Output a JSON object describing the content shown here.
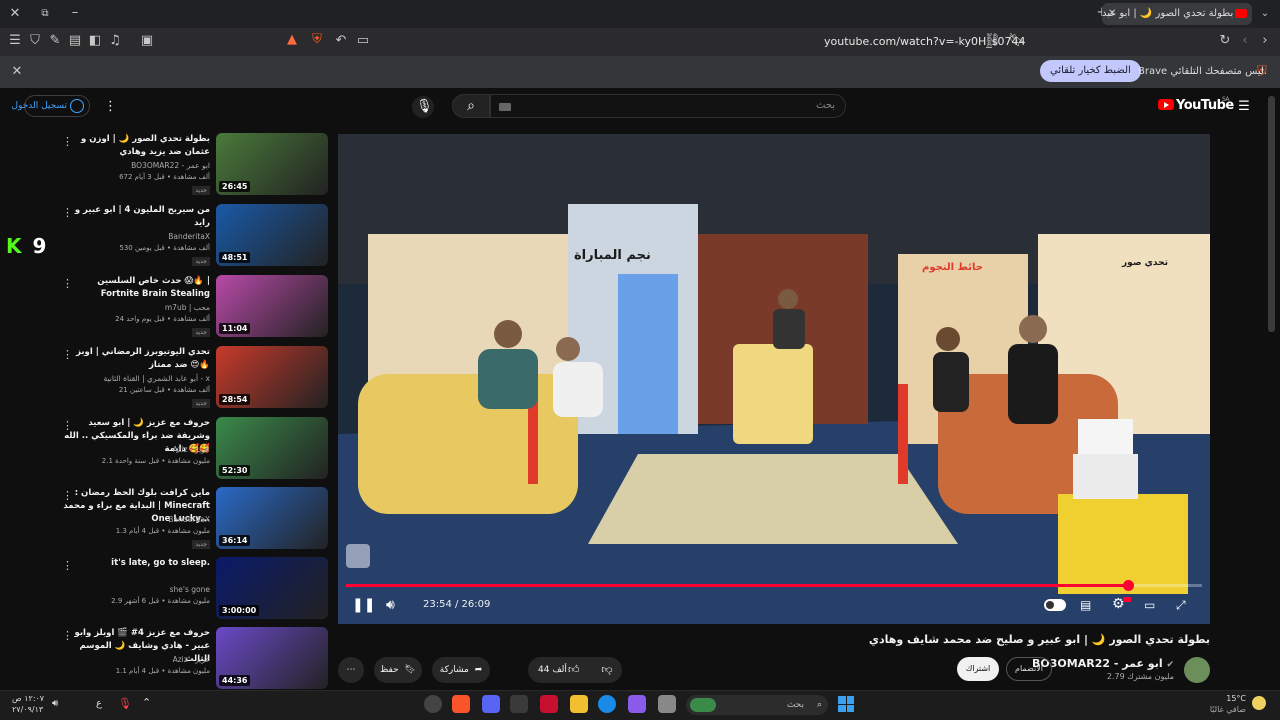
{
  "browser": {
    "tab_title": "بطولة تحدي الصور 🌙 | ابو عبد",
    "url": "youtube.com/watch?v=-ky0H_s0744",
    "shield_count": "98",
    "infobar_text": "Brave ليس متصفحك التلقائي.",
    "infobar_button": "الضبط كخيار تلقائي"
  },
  "header": {
    "logo_text": "YouTube",
    "logo_region": "SA",
    "search_placeholder": "بحث",
    "signin_label": "تسجيل الدخول"
  },
  "overlay_badge": {
    "letter": "K",
    "number": "9"
  },
  "recommendations": [
    {
      "title": "بطولة تحدي الصور 🌙 | اوزن و عثمان ضد يزيد وهادي",
      "channel": "BO3OMAR22 - ابو عمر",
      "stats": "672 ألف مشاهدة • قبل 3 أيام",
      "duration": "26:45",
      "badge": "جديد",
      "thumb": "#4a7a3a"
    },
    {
      "title": "من سيربح المليون 4 | ابو عبير و رايد",
      "channel": "BanderitaX",
      "stats": "530 ألف مشاهدة • قبل يومين",
      "duration": "48:51",
      "badge": "جديد",
      "thumb": "#1a5aa8"
    },
    {
      "title": "حدث خاص السلسين 😱🔥 | Fortnite Brain Stealing",
      "channel": "m7ub | محب",
      "stats": "24 ألف مشاهدة • قبل يوم واحد",
      "duration": "11:04",
      "badge": "جديد",
      "thumb": "#b84aa8"
    },
    {
      "title": "تحدي اليوتيوبرز الرمضاني | اوبز ضد ممتاز 😍🔥",
      "channel": "أبو عابد الشمري | القناة الثانية - x",
      "stats": "21 ألف مشاهدة • قبل ساعتين",
      "duration": "28:54",
      "badge": "جديد",
      "thumb": "#c83a2a"
    },
    {
      "title": "حروف مع عزيز 🌙 | ابو سعيد وشريفة ضد براء والمكسيكي .. الله دايمة 🥰🥰",
      "channel": "Aziz - عزيز",
      "stats": "2.1 مليون مشاهدة • قبل سنة واحدة",
      "duration": "52:30",
      "badge": "",
      "thumb": "#3a8a4a"
    },
    {
      "title": "ماين كرافت بلوك الحظ رمضان : البداية مع براء و محمد | Minecraft One Lucky...",
      "channel": "BanderitaX",
      "stats": "1.3 مليون مشاهدة • قبل 4 أيام",
      "duration": "36:14",
      "badge": "جديد",
      "thumb": "#2a6ac8"
    },
    {
      "title": "it's late, go to sleep.",
      "channel": "she's gone",
      "stats": "2.9 مليون مشاهدة • قبل 6 أشهر",
      "duration": "3:00:00",
      "badge": "",
      "thumb": "#0a1a6a"
    },
    {
      "title": "حروف مع عزيز 4# 🎬 اوبلز وابو عبير - هادي وشايف 🌙 الموسم الثالث",
      "channel": "Aziz - عزيز",
      "stats": "1.1 مليون مشاهدة • قبل 4 أيام",
      "duration": "44:36",
      "badge": "",
      "thumb": "#6a4ac8"
    }
  ],
  "player": {
    "current_time": "23:54",
    "total_time": "26:09",
    "time_display": "23:54 / 26:09",
    "progress_fraction": 0.914,
    "scene_text_1": "نجم المباراة",
    "scene_text_2": "حائط النجوم",
    "scene_text_3": "تحدي صور"
  },
  "video": {
    "title": "بطولة تحدي الصور 🌙 | ابو عبير و صليح ضد محمد شايف وهادي",
    "channel": "BO3OMAR22 - ابو عمر",
    "subscribers": "2.79 مليون مشترك",
    "join_label": "الانضمام",
    "subscribe_label": "اشتراك",
    "likes": "44 ألف",
    "share_label": "مشاركة",
    "save_label": "حفظ"
  },
  "taskbar": {
    "search_placeholder": "بحث",
    "weather_temp": "15°C",
    "weather_desc": "صافي غالبًا",
    "time": "١٢:٠٧ ص",
    "date": "٢٧/٠٩/١٣",
    "lang": "ع"
  },
  "colors": {
    "accent_red": "#ff0033",
    "link_blue": "#3ea6ff",
    "background": "#0f0f0f"
  }
}
